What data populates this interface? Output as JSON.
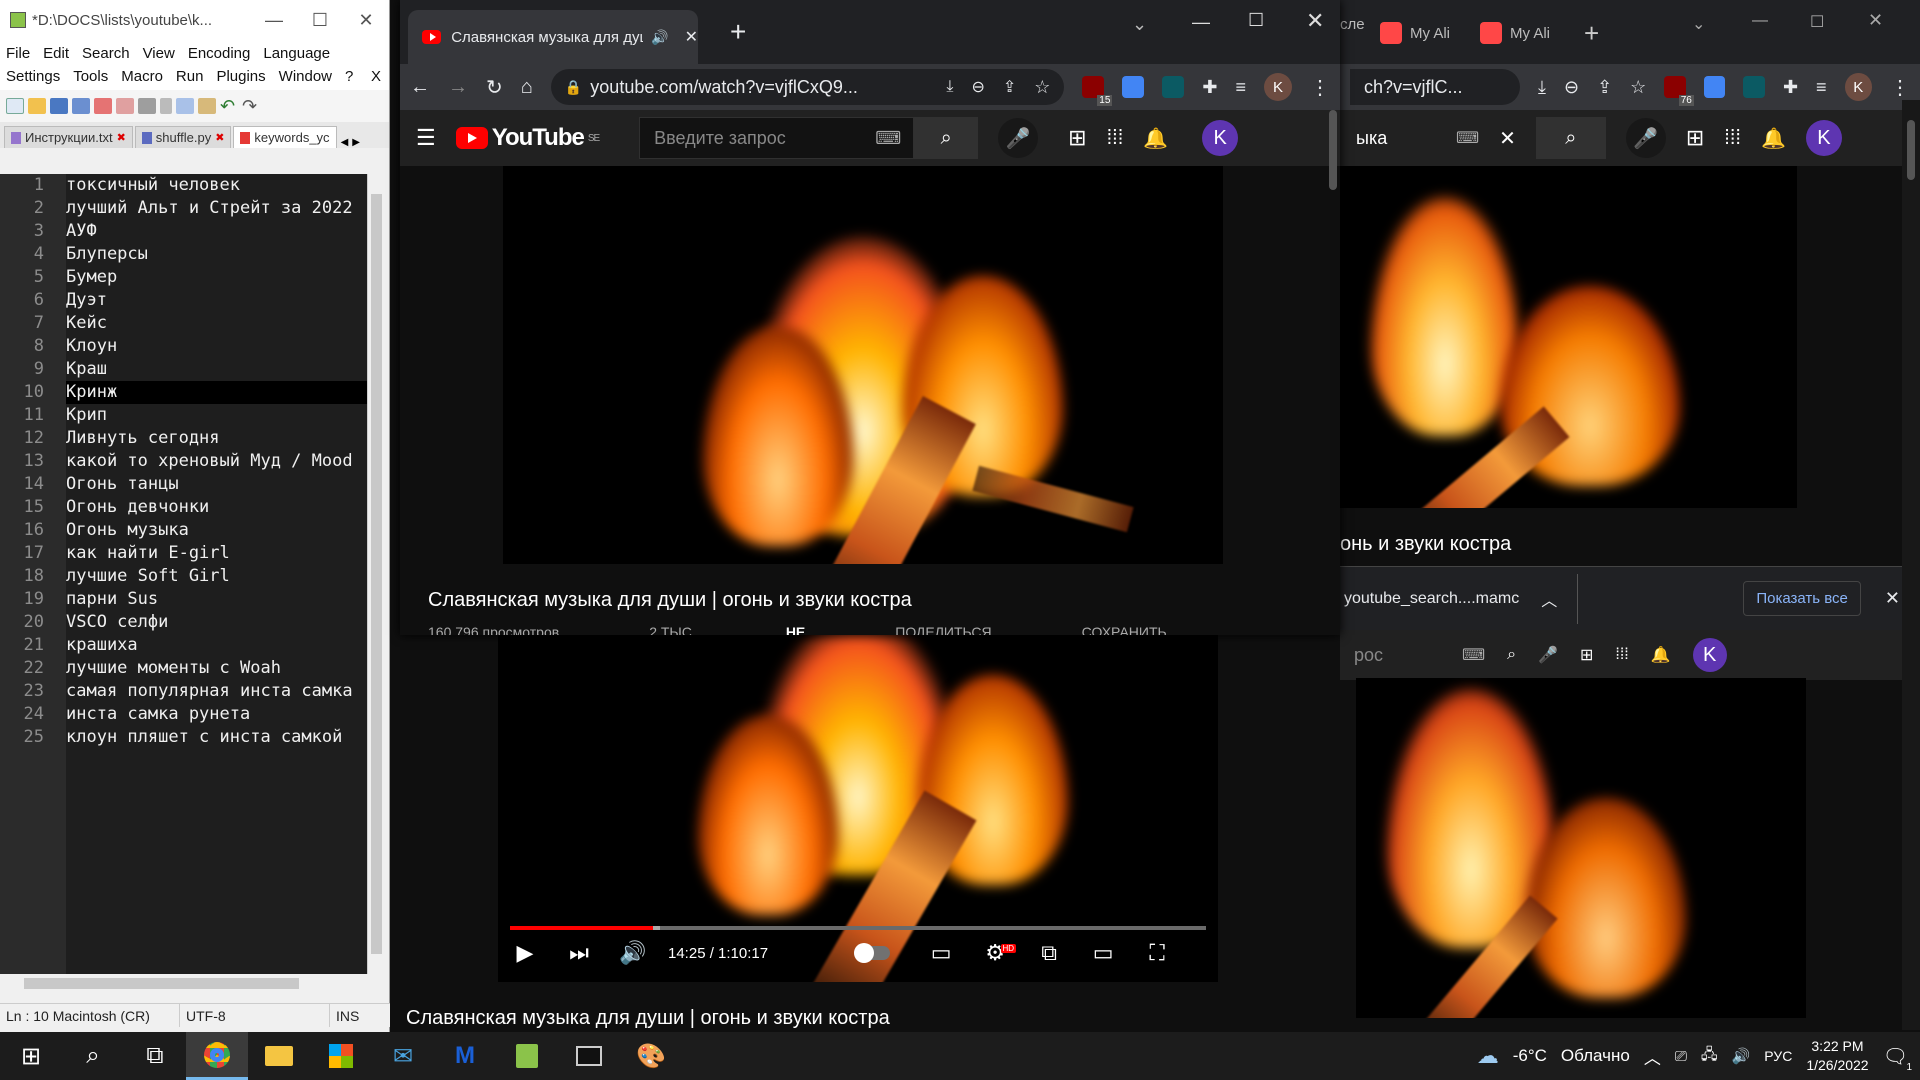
{
  "notepad": {
    "title": "*D:\\DOCS\\lists\\youtube\\k...",
    "menu": [
      "File",
      "Edit",
      "Search",
      "View",
      "Encoding",
      "Language",
      "Settings",
      "Tools",
      "Macro",
      "Run",
      "Plugins",
      "Window",
      "?"
    ],
    "close_x": "X",
    "tabs": [
      {
        "label": "Инструкции.txt",
        "active": false
      },
      {
        "label": "shuffle.py",
        "active": false
      },
      {
        "label": "keywords_yc",
        "active": true
      }
    ],
    "lines": [
      "токсичный человек",
      "лучший Альт и Стрейт за 2022",
      "АУФ",
      "Блуперсы",
      "Бумер",
      "Дуэт",
      "Кейс",
      "Клоун",
      "Краш",
      "Кринж",
      "Крип",
      "Ливнуть сегодня",
      "какой то хреновый Муд / Mood",
      "Огонь танцы",
      "Огонь девчонки",
      "Огонь музыка",
      "как найти E-girl",
      "лучшие Soft Girl",
      "парни Sus",
      "VSCO селфи",
      "крашиха",
      "лучшие моменты с Woah",
      "самая популярная инста самка",
      "инста самка рунета",
      "клоун пляшет с инста самкой"
    ],
    "current_line": 10,
    "status": {
      "position": "Ln : 10    Macintosh (CR)",
      "encoding": "UTF-8",
      "mode": "INS"
    }
  },
  "chrome1": {
    "tab_title": "Славянская музыка для душ",
    "url": "youtube.com/watch?v=vjflCxQ9...",
    "ext_badge": "15",
    "profile": "K",
    "search_placeholder": "Введите запрос",
    "region": "SE",
    "logo": "YouTube",
    "video_title": "Славянская музыка для души | огонь и звуки костра",
    "meta_partial": "160 796 просмотров",
    "actions": [
      "2 ТЫС.",
      "НЕ",
      "ПОДЕЛИТЬСЯ",
      "СОХРАНИТЬ"
    ]
  },
  "chrome2": {
    "tabs": [
      "сле",
      "My Ali",
      "My Ali"
    ],
    "url": "ch?v=vjflC...",
    "ext_badge": "76",
    "profile": "K",
    "search_value": "ыка",
    "video_title_partial": "онь и звуки костра",
    "download_file": "youtube_search....mamc",
    "show_all": "Показать все"
  },
  "chrome3": {
    "search_value": "рос",
    "profile": "K"
  },
  "player": {
    "time": "14:25 / 1:10:17",
    "progress_fraction": 0.205,
    "loaded_fraction": 0.215,
    "hd_badge": "HD",
    "video_title": "Славянская музыка для души | огонь и звуки костра"
  },
  "taskbar": {
    "weather_temp": "-6°C",
    "weather_text": "Облачно",
    "language": "РУС",
    "time": "3:22 PM",
    "date": "1/26/2022",
    "notif_count": "1"
  },
  "colors": {
    "yt_red": "#ff0000",
    "accent": "#76b9ed",
    "avatar_purple": "#5e35b1"
  }
}
